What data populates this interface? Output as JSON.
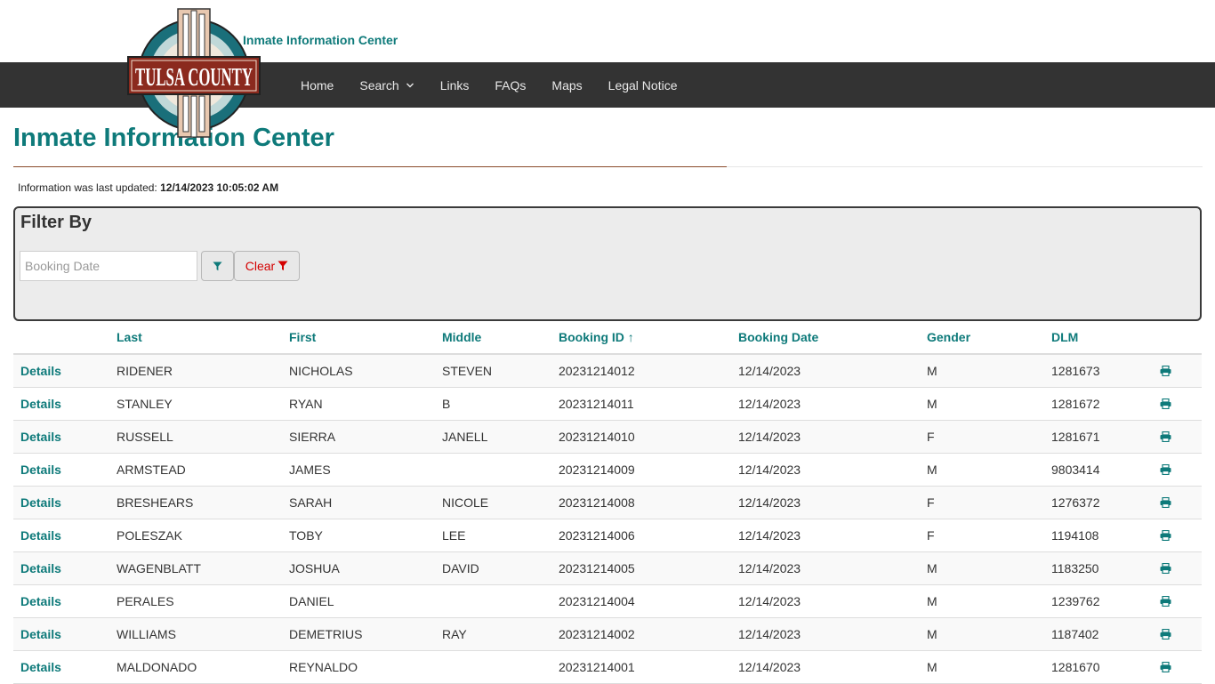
{
  "header": {
    "logo_alt": "TULSA COUNTY",
    "site_title": "Inmate Information Center"
  },
  "nav": {
    "items": [
      {
        "label": "Home"
      },
      {
        "label": "Search"
      },
      {
        "label": "Links"
      },
      {
        "label": "FAQs"
      },
      {
        "label": "Maps"
      },
      {
        "label": "Legal Notice"
      }
    ]
  },
  "page": {
    "title": "Inmate Information Center",
    "updated_prefix": "Information was last updated:",
    "updated_value": "12/14/2023 10:05:02 AM"
  },
  "filter": {
    "title": "Filter By",
    "date_placeholder": "Booking Date",
    "date_value": "",
    "clear_label": "Clear"
  },
  "table": {
    "columns": [
      "",
      "Last",
      "First",
      "Middle",
      "Booking ID ↑",
      "Booking Date",
      "Gender",
      "DLM",
      ""
    ],
    "details_label": "Details",
    "rows": [
      {
        "last": "RIDENER",
        "first": "NICHOLAS",
        "middle": "STEVEN",
        "booking_id": "20231214012",
        "booking_date": "12/14/2023",
        "gender": "M",
        "dlm": "1281673"
      },
      {
        "last": "STANLEY",
        "first": "RYAN",
        "middle": "B",
        "booking_id": "20231214011",
        "booking_date": "12/14/2023",
        "gender": "M",
        "dlm": "1281672"
      },
      {
        "last": "RUSSELL",
        "first": "SIERRA",
        "middle": "JANELL",
        "booking_id": "20231214010",
        "booking_date": "12/14/2023",
        "gender": "F",
        "dlm": "1281671"
      },
      {
        "last": "ARMSTEAD",
        "first": "JAMES",
        "middle": "",
        "booking_id": "20231214009",
        "booking_date": "12/14/2023",
        "gender": "M",
        "dlm": "9803414"
      },
      {
        "last": "BRESHEARS",
        "first": "SARAH",
        "middle": "NICOLE",
        "booking_id": "20231214008",
        "booking_date": "12/14/2023",
        "gender": "F",
        "dlm": "1276372"
      },
      {
        "last": "POLESZAK",
        "first": "TOBY",
        "middle": "LEE",
        "booking_id": "20231214006",
        "booking_date": "12/14/2023",
        "gender": "F",
        "dlm": "1194108"
      },
      {
        "last": "WAGENBLATT",
        "first": "JOSHUA",
        "middle": "DAVID",
        "booking_id": "20231214005",
        "booking_date": "12/14/2023",
        "gender": "M",
        "dlm": "1183250"
      },
      {
        "last": "PERALES",
        "first": "DANIEL",
        "middle": "",
        "booking_id": "20231214004",
        "booking_date": "12/14/2023",
        "gender": "M",
        "dlm": "1239762"
      },
      {
        "last": "WILLIAMS",
        "first": "DEMETRIUS",
        "middle": "RAY",
        "booking_id": "20231214002",
        "booking_date": "12/14/2023",
        "gender": "M",
        "dlm": "1187402"
      },
      {
        "last": "MALDONADO",
        "first": "REYNALDO",
        "middle": "",
        "booking_id": "20231214001",
        "booking_date": "12/14/2023",
        "gender": "M",
        "dlm": "1281670"
      }
    ]
  },
  "colors": {
    "accent": "#0e7a7a",
    "navbar": "#333333",
    "clear": "#d40000",
    "rule": "#8a4a2a"
  }
}
